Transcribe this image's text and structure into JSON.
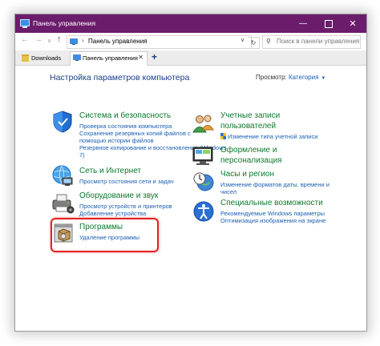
{
  "window": {
    "title": "Панель управления",
    "min_symbol": "—",
    "close_symbol": "✕"
  },
  "address": {
    "back_symbol": "←",
    "forward_symbol": "→",
    "history_symbol": "∨",
    "up_symbol": "↑",
    "separator": "›",
    "path": "Панель управления",
    "drop_symbol": "∨",
    "refresh_symbol": "↻",
    "search_symbol": "⚲",
    "search_placeholder": "Поиск в панели управления"
  },
  "tabs": [
    {
      "label": "Downloads",
      "icon": "folder-icon"
    },
    {
      "label": "Панель управления",
      "icon": "control-panel-icon",
      "close_symbol": "✕"
    }
  ],
  "new_tab_symbol": "+",
  "content": {
    "heading": "Настройка параметров компьютера",
    "view_label": "Просмотр:",
    "view_value": "Категория",
    "view_caret": "▼"
  },
  "categories": {
    "system_security": {
      "icon": "shield-icon",
      "title": "Система и безопасность",
      "links": [
        "Проверка состояния компьютера",
        "Сохранение резервных копий файлов с",
        "помощью истории файлов",
        "Резервное копирование и восстановление (Windows",
        "7)"
      ]
    },
    "network": {
      "icon": "network-icon",
      "title": "Сеть и Интернет",
      "links": [
        "Просмотр состояния сети и задач"
      ]
    },
    "hardware": {
      "icon": "printer-icon",
      "title": "Оборудование и звук",
      "links": [
        "Просмотр устройств и принтеров",
        "Добавление устройства"
      ]
    },
    "programs": {
      "icon": "programs-icon",
      "title": "Программы",
      "links": [
        "Удаление программы"
      ]
    },
    "accounts": {
      "icon": "users-icon",
      "title_lines": [
        "Учетные записи",
        "пользователей"
      ],
      "links": [
        "Изменение типа учетной записи"
      ]
    },
    "appearance": {
      "icon": "monitor-icon",
      "title_lines": [
        "Оформление и",
        "персонализация"
      ]
    },
    "clock": {
      "icon": "clock-globe-icon",
      "title": "Часы и регион",
      "links": [
        "Изменение форматов даты, времени и",
        "чисел"
      ]
    },
    "ease": {
      "icon": "accessibility-icon",
      "title": "Специальные возможности",
      "links": [
        "Рекомендуемые Windows параметры",
        "Оптимизация изображения на экране"
      ]
    }
  },
  "colors": {
    "titlebar": "#6b1d6b",
    "category_title": "#0d7a2c",
    "link": "#1a5fb4",
    "heading": "#1a3e8c",
    "highlight_border": "#e52020"
  }
}
